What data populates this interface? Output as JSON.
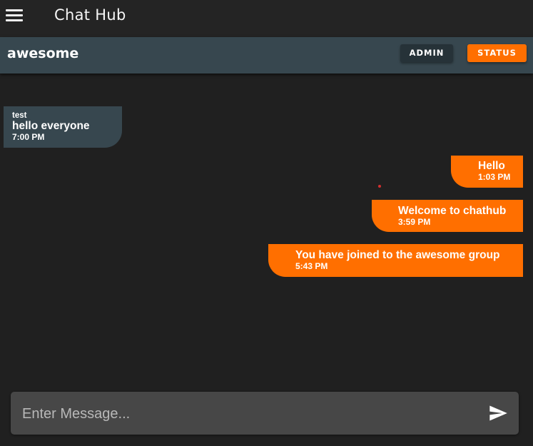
{
  "app": {
    "title": "Chat Hub"
  },
  "group": {
    "name": "awesome",
    "admin_label": "ADMIN",
    "status_label": "STATUS"
  },
  "messages": [
    {
      "direction": "incoming",
      "sender": "test",
      "text": "hello everyone",
      "time": "7:00 PM"
    },
    {
      "direction": "outgoing",
      "text": "Hello",
      "time": "1:03 PM"
    },
    {
      "direction": "outgoing",
      "text": "Welcome to chathub",
      "time": "3:59 PM"
    },
    {
      "direction": "outgoing",
      "text": "You have joined to the awesome group",
      "time": "5:43 PM"
    }
  ],
  "composer": {
    "placeholder": "Enter Message...",
    "value": ""
  },
  "icons": {
    "menu": "hamburger-menu-icon",
    "send": "send-icon"
  },
  "colors": {
    "background": "#202020",
    "topbar": "#242424",
    "groupbar": "#37474f",
    "accent": "#ff6f00",
    "admin_button": "#263238",
    "incoming_bubble": "#37474f",
    "input": "#474747"
  }
}
